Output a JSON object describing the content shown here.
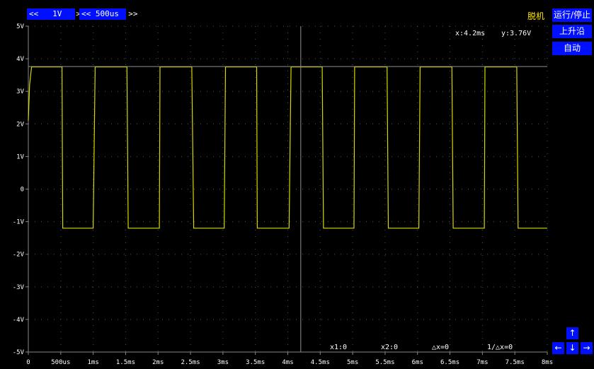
{
  "controls": {
    "volt": {
      "left": "<<",
      "value": "1V",
      "right": ">>"
    },
    "time": {
      "left": "<<",
      "value": "500us",
      "right": ">>"
    }
  },
  "side_buttons": {
    "status": "脱机",
    "run_stop": "运行/停止",
    "rising_edge": "上升沿",
    "auto": "自动"
  },
  "nav_arrows": {
    "up": "↑",
    "down": "↓",
    "left": "←",
    "right": "→"
  },
  "cursor_readout": {
    "x": "x:4.2ms",
    "y": "y:3.76V"
  },
  "measurements": {
    "x1": "x1:0",
    "x2": "x2:0",
    "dx": "△x=0",
    "inv_dx": "1/△x=0"
  },
  "colors": {
    "trace": "#d8d800",
    "grid_dot": "#555555",
    "axis": "#888888",
    "cursor": "#909090",
    "button": "#0010ff"
  },
  "chart_data": {
    "type": "line",
    "x_unit": "ms",
    "y_unit": "V",
    "xlim": [
      0,
      8
    ],
    "ylim": [
      -5,
      5
    ],
    "x_ticks": [
      0,
      0.5,
      1,
      1.5,
      2,
      2.5,
      3,
      3.5,
      4,
      4.5,
      5,
      5.5,
      6,
      6.5,
      7,
      7.5,
      8
    ],
    "x_tick_labels": [
      "0",
      "500us",
      "1ms",
      "1.5ms",
      "2ms",
      "2.5ms",
      "3ms",
      "3.5ms",
      "4ms",
      "4.5ms",
      "5ms",
      "5.5ms",
      "6ms",
      "6.5ms",
      "7ms",
      "7.5ms",
      "8ms"
    ],
    "y_ticks": [
      5,
      4,
      3,
      2,
      1,
      0,
      -1,
      -2,
      -3,
      -4,
      -5
    ],
    "y_tick_labels": [
      "5V",
      "4V",
      "3V",
      "2V",
      "1V",
      "0",
      "-1V",
      "-2V",
      "-3V",
      "-4V",
      "-5V"
    ],
    "grid": true,
    "cursor_x": 4.2,
    "cursor_y": 3.76,
    "series": [
      {
        "x": [
          0,
          0.02,
          0.05,
          0.52,
          0.53,
          1.0,
          1.03,
          1.52,
          1.54,
          2.02,
          2.03,
          2.52,
          2.55,
          3.02,
          3.04,
          3.52,
          3.53,
          4.02,
          4.05,
          4.53,
          4.55,
          5.02,
          5.03,
          5.53,
          5.55,
          6.02,
          6.04,
          6.53,
          6.55,
          7.03,
          7.04,
          7.53,
          7.55,
          8.0
        ],
        "y": [
          2.1,
          3.2,
          3.75,
          3.75,
          -1.2,
          -1.2,
          3.75,
          3.75,
          -1.2,
          -1.2,
          3.75,
          3.75,
          -1.2,
          -1.2,
          3.75,
          3.75,
          -1.2,
          -1.2,
          3.75,
          3.75,
          -1.2,
          -1.2,
          3.75,
          3.75,
          -1.2,
          -1.2,
          3.75,
          3.75,
          -1.2,
          -1.2,
          3.75,
          3.75,
          -1.2,
          -1.2
        ]
      }
    ]
  }
}
